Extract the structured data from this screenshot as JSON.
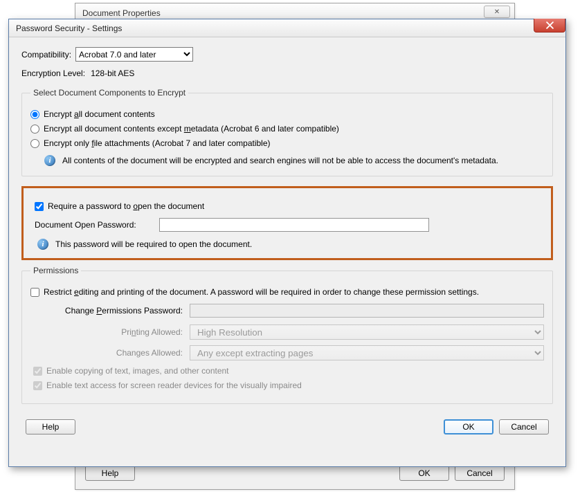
{
  "parent": {
    "title": "Document Properties",
    "help": "Help",
    "ok": "OK",
    "cancel": "Cancel"
  },
  "dialog": {
    "title": "Password Security - Settings"
  },
  "compat": {
    "label": "Compatibility:",
    "value": "Acrobat 7.0 and later"
  },
  "encryption": {
    "label": "Encryption  Level:",
    "value": "128-bit AES"
  },
  "components": {
    "legend": "Select Document Components to Encrypt",
    "opt_all_pre": "Encrypt ",
    "opt_all_u": "a",
    "opt_all_post": "ll document contents",
    "opt_meta_pre": "Encrypt all document contents except ",
    "opt_meta_u": "m",
    "opt_meta_post": "etadata (Acrobat 6 and later compatible)",
    "opt_file_pre": "Encrypt only ",
    "opt_file_u": "f",
    "opt_file_post": "ile attachments (Acrobat 7 and later compatible)",
    "info": "All contents of the document will be encrypted and search engines will not be able to access the document's metadata."
  },
  "openpw": {
    "check_pre": "Require a password to ",
    "check_u": "o",
    "check_post": "pen the document",
    "label": "Document Open Password:",
    "info": "This password will be required to open the document."
  },
  "permissions": {
    "legend": "Permissions",
    "restrict_pre": "Restrict ",
    "restrict_u": "e",
    "restrict_post": "diting and printing of the document. A password will be required in order to change these permission settings.",
    "change_pw_pre": "Change ",
    "change_pw_u": "P",
    "change_pw_post": "ermissions Password:",
    "printing_pre": "Pri",
    "printing_u": "n",
    "printing_post": "ting Allowed:",
    "printing_value": "High Resolution",
    "changes_pre": "Chan",
    "changes_u": "g",
    "changes_post": "es Allowed:",
    "changes_value": "Any except extracting pages",
    "copy": "Enable copying of text, images, and other content",
    "screen": "Enable text access for screen reader devices for the visually impaired"
  },
  "footer": {
    "help": "Help",
    "ok": "OK",
    "cancel": "Cancel"
  }
}
